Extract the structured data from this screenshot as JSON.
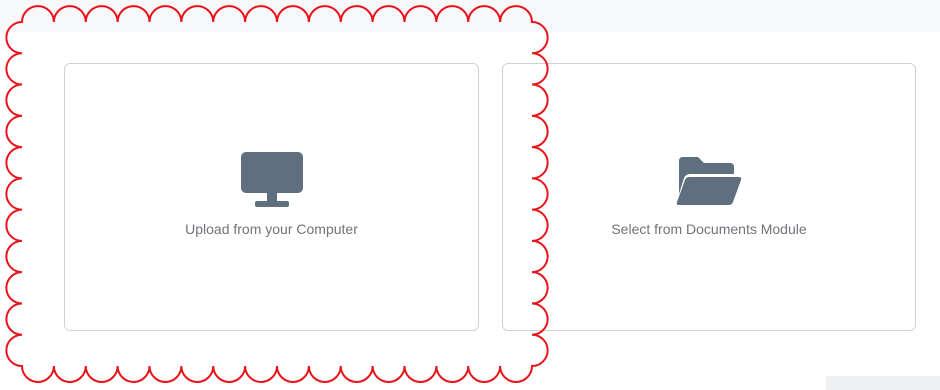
{
  "upload_options": {
    "computer": {
      "label": "Upload from your Computer",
      "icon": "monitor-icon"
    },
    "documents": {
      "label": "Select from Documents Module",
      "icon": "folder-open-icon"
    }
  },
  "colors": {
    "icon": "#5f6f80",
    "label": "#6f7479",
    "border": "#cfd3d7",
    "annotation": "#e8141b"
  }
}
